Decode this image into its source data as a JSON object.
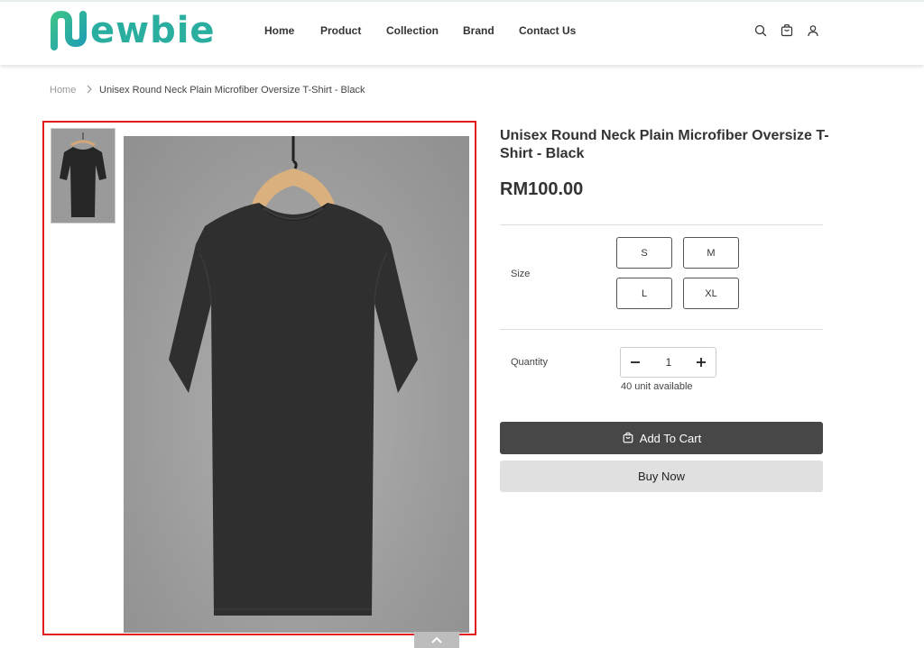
{
  "brand": {
    "name": "ewbie",
    "color": "#2aaea0"
  },
  "nav": [
    "Home",
    "Product",
    "Collection",
    "Brand",
    "Contact Us"
  ],
  "header_icons": [
    "search-icon",
    "cart-icon",
    "user-icon"
  ],
  "breadcrumb": {
    "home": "Home",
    "current": "Unisex Round Neck Plain Microfiber Oversize T-Shirt - Black"
  },
  "product": {
    "title": "Unisex Round Neck Plain Microfiber Oversize T-Shirt - Black",
    "price": "RM100.00",
    "size_label": "Size",
    "sizes": [
      "S",
      "M",
      "L",
      "XL"
    ],
    "quantity_label": "Quantity",
    "quantity": "1",
    "availability": "40 unit available",
    "add_to_cart": "Add To Cart",
    "buy_now": "Buy Now"
  },
  "colors": {
    "accent": "#2aaea0",
    "highlight_frame": "#e11c1c",
    "cart_button": "#474747",
    "buy_button": "#e0e0e0"
  }
}
